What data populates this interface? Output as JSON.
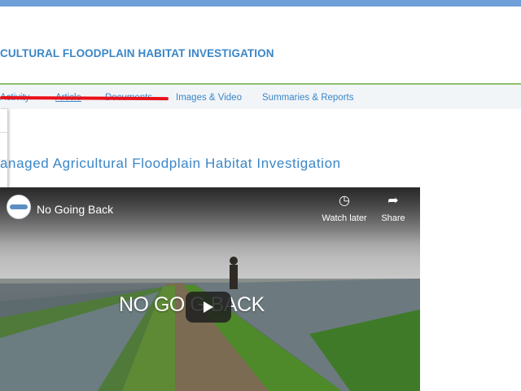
{
  "header": {
    "site_title": "CULTURAL FLOODPLAIN HABITAT INVESTIGATION"
  },
  "nav": {
    "items": [
      {
        "label": "Activity"
      },
      {
        "label": "Article"
      },
      {
        "label": "Documents"
      },
      {
        "label": "Images & Video"
      },
      {
        "label": "Summaries & Reports"
      }
    ],
    "active": "Article"
  },
  "main": {
    "heading": "anaged Agricultural Floodplain Habitat Investigation"
  },
  "video": {
    "title": "No Going Back",
    "watch_later": "Watch later",
    "share": "Share",
    "overlay_text": "NO GO      G BACK"
  },
  "colors": {
    "accent": "#3a86c7",
    "topbar": "#6f9fd8",
    "rule": "#8ec16a",
    "annotation": "#e8121a"
  },
  "icons": [
    "clock-icon",
    "share-icon",
    "play-icon",
    "channel-logo"
  ]
}
